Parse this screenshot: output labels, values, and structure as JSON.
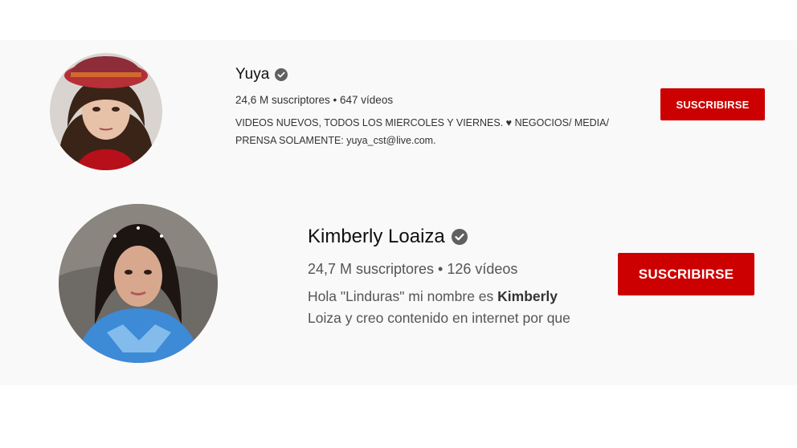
{
  "channels": [
    {
      "name": "Yuya",
      "verified": true,
      "stats": "24,6 M suscriptores • 647 vídeos",
      "description_lines": [
        "VIDEOS NUEVOS, TODOS LOS MIERCOLES Y VIERNES. ♥ NEGOCIOS/ MEDIA/",
        "PRENSA SOLAMENTE: yuya_cst@live.com."
      ],
      "subscribe_label": "SUSCRIBIRSE"
    },
    {
      "name": "Kimberly Loaiza",
      "verified": true,
      "stats": "24,7 M suscriptores • 126 vídeos",
      "description_line1_pre": "Hola \"Linduras\" mi nombre es ",
      "description_line1_bold": "Kimberly",
      "description_line2": "Loiza y creo contenido en internet por que",
      "subscribe_label": "SUSCRIBIRSE"
    }
  ],
  "colors": {
    "band_bg": "#f9f9f9",
    "subscribe_red": "#cc0000",
    "verified_grey": "#606060"
  },
  "icons": [
    "verified-check-icon"
  ]
}
